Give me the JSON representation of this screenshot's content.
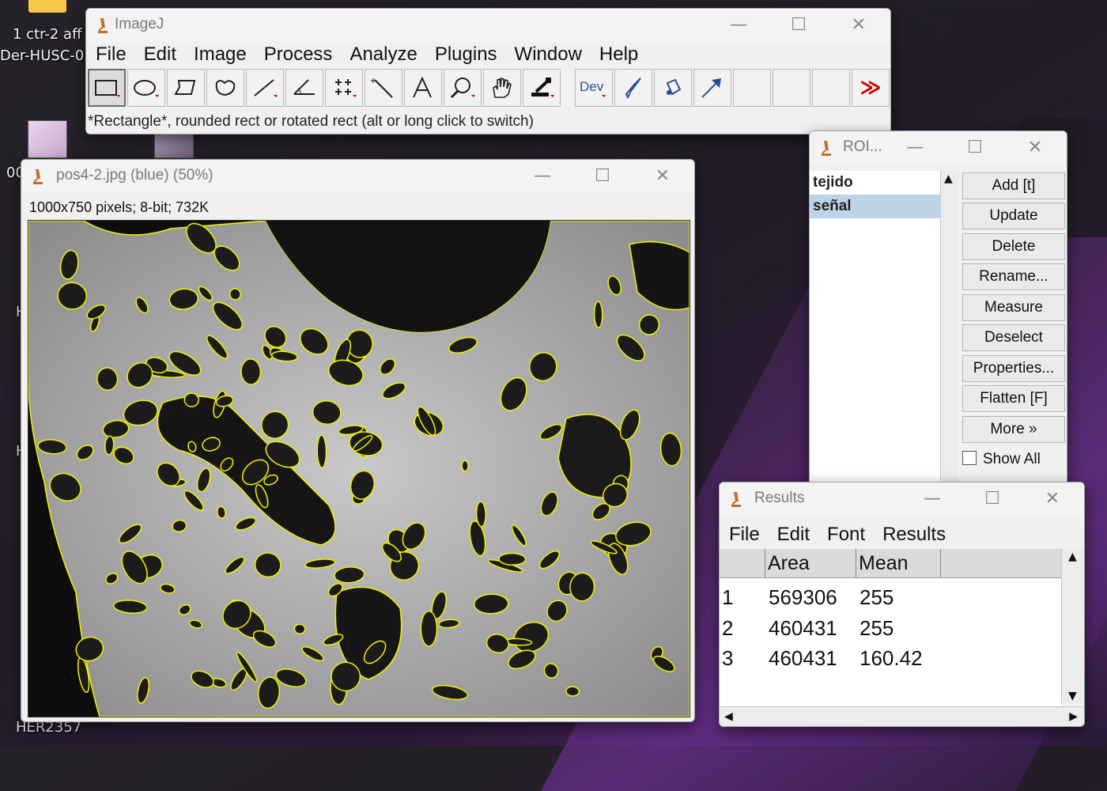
{
  "desktop": {
    "icon1_label": "1 ctr-2 aff",
    "icon2_label": "Der-HUSC-0",
    "icon3_label": "00",
    "partial1": "H",
    "partial2": "H",
    "bottom_label": "HER2357"
  },
  "imagej": {
    "title": "ImageJ",
    "menu": [
      "File",
      "Edit",
      "Image",
      "Process",
      "Analyze",
      "Plugins",
      "Window",
      "Help"
    ],
    "tools": [
      "rectangle-tool",
      "oval-tool",
      "polygon-tool",
      "freehand-tool",
      "line-tool",
      "angle-tool",
      "point-tool",
      "wand-tool",
      "text-tool",
      "magnifier-tool",
      "hand-tool",
      "color-picker-tool",
      "dev-tool",
      "brush-tool",
      "flood-fill-tool",
      "arrow-tool",
      "empty-slot",
      "empty-slot",
      "empty-slot",
      "more-tools"
    ],
    "dev_label": "Dev",
    "more_symbol": "≫",
    "status": "*Rectangle*, rounded rect or rotated rect (alt or long click to switch)"
  },
  "image_window": {
    "title": "pos4-2.jpg (blue) (50%)",
    "info": "1000x750 pixels; 8-bit; 732K"
  },
  "roi_manager": {
    "title": "ROI...",
    "items": [
      "tejido",
      "señal"
    ],
    "selected_index": 1,
    "buttons": [
      "Add [t]",
      "Update",
      "Delete",
      "Rename...",
      "Measure",
      "Deselect",
      "Properties...",
      "Flatten [F]",
      "More »"
    ],
    "show_all_label": "Show All",
    "show_all_checked": false
  },
  "results": {
    "title": "Results",
    "menu": [
      "File",
      "Edit",
      "Font",
      "Results"
    ],
    "columns": [
      "",
      "Area",
      "Mean"
    ],
    "rows": [
      [
        "1",
        "569306",
        "255"
      ],
      [
        "2",
        "460431",
        "255"
      ],
      [
        "3",
        "460431",
        "160.42"
      ]
    ]
  },
  "window_controls": {
    "minimize": "—",
    "maximize": "☐",
    "close": "✕"
  }
}
